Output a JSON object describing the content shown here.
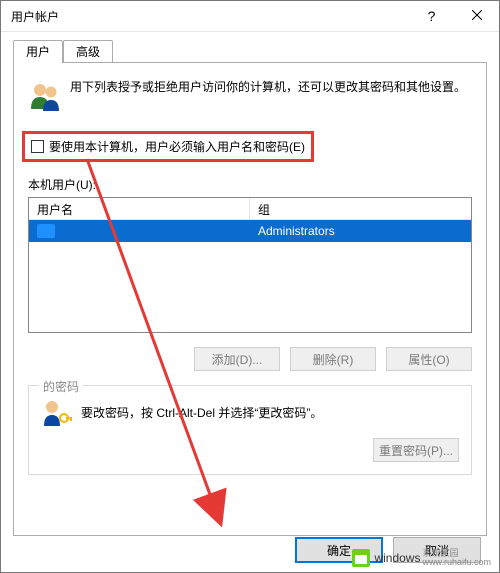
{
  "window": {
    "title": "用户帐户"
  },
  "tabs": {
    "users": "用户",
    "advanced": "高级"
  },
  "intro": "用下列表授予或拒绝用户访问你的计算机，还可以更改其密码和其他设置。",
  "checkbox": {
    "label": "要使用本计算机，用户必须输入用户名和密码(E)"
  },
  "list": {
    "caption": "本机用户(U):",
    "cols": {
      "user": "用户名",
      "group": "组"
    },
    "row": {
      "user": "",
      "group": "Administrators"
    }
  },
  "buttons": {
    "add": "添加(D)...",
    "remove": "删除(R)",
    "properties": "属性(O)",
    "reset": "重置密码(P)...",
    "ok": "确定",
    "cancel": "取消"
  },
  "pw": {
    "title": "的密码",
    "text": "要改密码，按 Ctrl-Alt-Del 并选择“更改密码”。"
  },
  "watermark": {
    "brand": "windows",
    "sub": "系统家园",
    "site": "www.ruhaifu.com"
  }
}
